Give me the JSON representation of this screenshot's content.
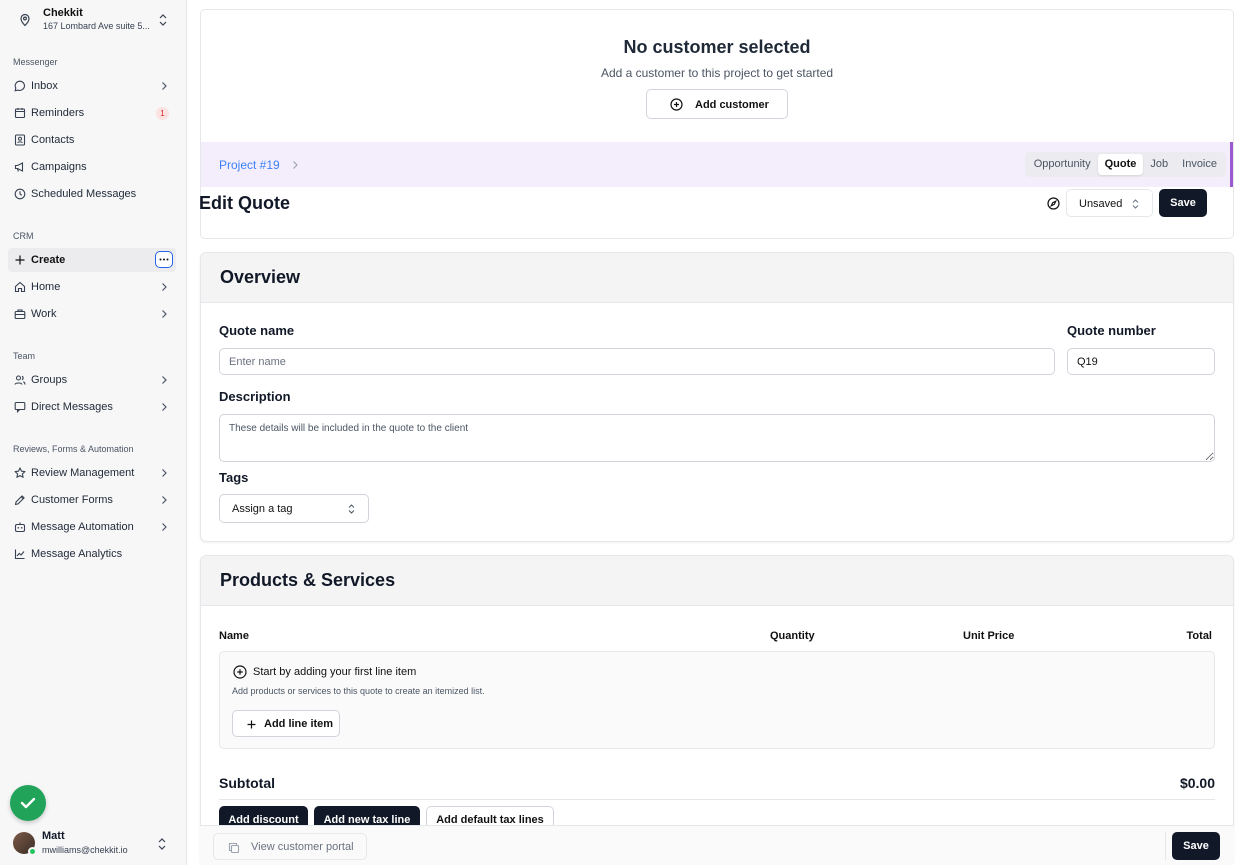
{
  "location": {
    "name": "Chekkit",
    "address": "167 Lombard Ave suite 5..."
  },
  "sections": {
    "messenger": "Messenger",
    "crm": "CRM",
    "team": "Team",
    "reviews": "Reviews, Forms & Automation"
  },
  "nav": {
    "inbox": "Inbox",
    "reminders": "Reminders",
    "reminders_badge": "1",
    "contacts": "Contacts",
    "campaigns": "Campaigns",
    "scheduled": "Scheduled Messages",
    "create": "Create",
    "home": "Home",
    "work": "Work",
    "groups": "Groups",
    "direct": "Direct Messages",
    "review_mgmt": "Review Management",
    "customer_forms": "Customer Forms",
    "message_automation": "Message Automation",
    "message_analytics": "Message Analytics"
  },
  "user": {
    "name": "Matt",
    "email": "mwilliams@chekkit.io"
  },
  "customer": {
    "title": "No customer selected",
    "subtitle": "Add a customer to this project to get started",
    "add_label": "Add customer"
  },
  "project": {
    "link": "Project #19",
    "tabs": [
      "Opportunity",
      "Quote",
      "Job",
      "Invoice"
    ],
    "selected_tab": "Quote"
  },
  "editor": {
    "title": "Edit Quote",
    "status": "Unsaved",
    "save_label": "Save"
  },
  "overview": {
    "heading": "Overview",
    "quote_name_label": "Quote name",
    "quote_name_placeholder": "Enter name",
    "quote_number_label": "Quote number",
    "quote_number_value": "Q19",
    "description_label": "Description",
    "description_placeholder": "These details will be included in the quote to the client",
    "tags_label": "Tags",
    "tags_select": "Assign a tag"
  },
  "products": {
    "heading": "Products & Services",
    "columns": {
      "name": "Name",
      "quantity": "Quantity",
      "unit_price": "Unit Price",
      "total": "Total"
    },
    "empty_title": "Start by adding your first line item",
    "empty_sub": "Add products or services to this quote to create an itemized list.",
    "add_line": "Add line item",
    "subtotal_label": "Subtotal",
    "subtotal_value": "$0.00",
    "add_discount": "Add discount",
    "add_tax": "Add new tax line",
    "add_default_tax": "Add default tax lines"
  },
  "bottom": {
    "portal": "View customer portal",
    "save_label": "Save"
  },
  "colors": {
    "accent_purple": "#9b59d0",
    "link_blue": "#3b82f6",
    "dark_button": "#111827",
    "success_green": "#22a35a"
  }
}
